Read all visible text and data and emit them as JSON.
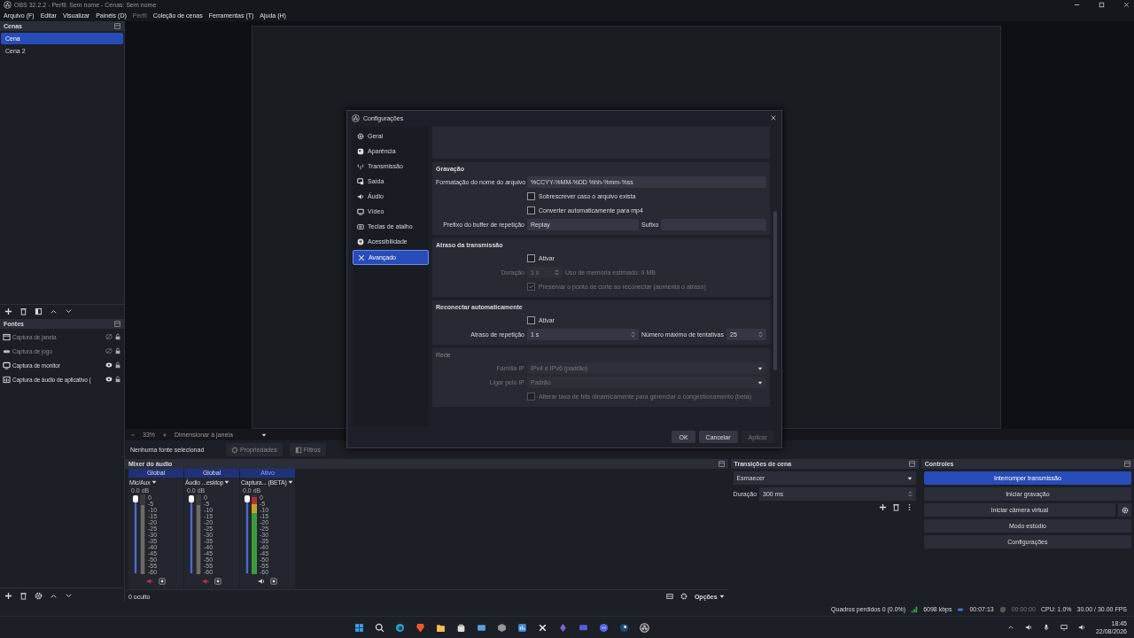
{
  "window": {
    "title": "OBS 32.2.2 - Perfil: Sem nome - Cenas: Sem nome"
  },
  "menu": [
    {
      "label": "Arquivo (F)",
      "disabled": false
    },
    {
      "label": "Editar",
      "disabled": false
    },
    {
      "label": "Visualizar",
      "disabled": false
    },
    {
      "label": "Painéis (D)",
      "disabled": false
    },
    {
      "label": "Perfil",
      "disabled": true
    },
    {
      "label": "Coleção de cenas",
      "disabled": false
    },
    {
      "label": "Ferramentas (T)",
      "disabled": false
    },
    {
      "label": "Ajuda (H)",
      "disabled": false
    }
  ],
  "scenes": {
    "title": "Cenas",
    "items": [
      {
        "label": "Cena",
        "selected": true
      },
      {
        "label": "Cena 2",
        "selected": false
      }
    ]
  },
  "sources": {
    "title": "Fontes",
    "items": [
      {
        "label": "Captura de janela",
        "kind": "window",
        "visible": false
      },
      {
        "label": "Captura de jogo",
        "kind": "game",
        "visible": false
      },
      {
        "label": "Captura de monitor",
        "kind": "monitor",
        "visible": true
      },
      {
        "label": "Captura de áudio de aplicativo (",
        "kind": "app-audio",
        "visible": true
      }
    ]
  },
  "preview": {
    "zoom": "33%",
    "scale_mode": "Dimensionar à janela"
  },
  "source_toolbar": {
    "status": "Nenhuma fonte selecionad",
    "buttons": [
      "Propriedades",
      "Filtros"
    ]
  },
  "mixer": {
    "title": "Mixer do áudio",
    "hidden": "0 oculto",
    "options": "Opções",
    "channels": [
      {
        "tag": "Global",
        "name": "Mic/Aux",
        "db": "0.0 dB",
        "level": 1,
        "muted": true,
        "active": false,
        "scale": [
          "0",
          "-5",
          "-10",
          "-15",
          "-20",
          "-25",
          "-30",
          "-35",
          "-40",
          "-45",
          "-50",
          "-55",
          "-60"
        ]
      },
      {
        "tag": "Global",
        "name": "Áudio ...esktop",
        "db": "0.0 dB",
        "level": 1,
        "muted": true,
        "active": false,
        "scale": [
          "0",
          "-5",
          "-10",
          "-15",
          "-20",
          "-25",
          "-30",
          "-35",
          "-40",
          "-45",
          "-50",
          "-55",
          "-60"
        ]
      },
      {
        "tag": "Ativo",
        "name": "Captura... (BETA)",
        "db": "0.0 dB",
        "level": 1,
        "muted": false,
        "active": true,
        "scale": [
          "0",
          "-5",
          "-10",
          "-15",
          "-20",
          "-25",
          "-30",
          "-35",
          "-40",
          "-45",
          "-50",
          "-55",
          "-60"
        ]
      }
    ]
  },
  "transitions": {
    "title": "Transições de cena",
    "value": "Esmaecer",
    "duration_label": "Duração",
    "duration": "300 ms"
  },
  "controls": {
    "title": "Controles",
    "buttons": [
      {
        "label": "Interromper transmissão",
        "active": true
      },
      {
        "label": "Iniciar gravação",
        "active": false
      },
      {
        "label": "Iniciar câmera virtual",
        "active": false
      },
      {
        "label": "Modo estúdio",
        "active": false
      },
      {
        "label": "Configurações",
        "active": false
      }
    ]
  },
  "status_bar": {
    "dropped": "Quadros perdidos 0 (0.0%)",
    "bitrate": "6098 kbps",
    "stream_time": "00:07:13",
    "rec_time": "00:00:00",
    "cpu": "CPU: 1.0%",
    "fps": "30.00 / 30.00 FPS"
  },
  "taskbar": {
    "time": "18:45",
    "date": "22/08/2026"
  },
  "dialog": {
    "title": "Configurações",
    "nav": [
      {
        "label": "Geral",
        "kind": "gear",
        "selected": false
      },
      {
        "label": "Aparência",
        "kind": "palette",
        "selected": false
      },
      {
        "label": "Transmissão",
        "kind": "antenna",
        "selected": false
      },
      {
        "label": "Saída",
        "kind": "output",
        "selected": false
      },
      {
        "label": "Áudio",
        "kind": "speaker",
        "selected": false
      },
      {
        "label": "Vídeo",
        "kind": "monitor",
        "selected": false
      },
      {
        "label": "Teclas de atalho",
        "kind": "keyboard",
        "selected": false
      },
      {
        "label": "Acessibilidade",
        "kind": "access",
        "selected": false
      },
      {
        "label": "Avançado",
        "kind": "tools",
        "selected": true
      }
    ],
    "sections": [
      {
        "title": "Gravação",
        "disabled": false,
        "rows": [
          {
            "kind": "text",
            "label": "Formatação do nome do arquivo",
            "value": "%CCYY-%MM-%DD %hh-%mm-%ss",
            "disabled": false
          },
          {
            "kind": "check",
            "label": "Sobrescrever caso o arquivo exista",
            "checked": false,
            "disabled": false
          },
          {
            "kind": "check",
            "label": "Converter automaticamente para mp4",
            "checked": false,
            "disabled": false
          },
          {
            "kind": "text-pair",
            "label": "Prefixo do buffer de repetição",
            "value": "Replay",
            "label2": "Sufixo",
            "disabled": false
          }
        ]
      },
      {
        "title": "Atraso da transmissão",
        "disabled": false,
        "rows": [
          {
            "kind": "check",
            "label": "Ativar",
            "checked": false,
            "disabled": false
          },
          {
            "kind": "spin",
            "label": "Duração",
            "value": "1 s",
            "note": "Uso de memória estimado: 0 MB",
            "disabled": true
          },
          {
            "kind": "check",
            "label": "Preservar o ponto de corte ao reconectar (aumenta o atraso)",
            "checked": true,
            "disabled": true
          }
        ]
      },
      {
        "title": "Reconectar automaticamente",
        "disabled": false,
        "rows": [
          {
            "kind": "check",
            "label": "Ativar",
            "checked": false,
            "disabled": false
          },
          {
            "kind": "spin-pair",
            "label": "Atraso de repetição",
            "value": "1 s",
            "label2": "Número máximo de tentativas",
            "value2": "25",
            "disabled": false
          }
        ]
      },
      {
        "title": "Rede",
        "disabled": true,
        "rows": [
          {
            "kind": "select",
            "label": "Família IP",
            "value": "IPv4 e IPv6 (padrão)",
            "disabled": true
          },
          {
            "kind": "select",
            "label": "Ligar pelo IP",
            "value": "Padrão",
            "disabled": true
          },
          {
            "kind": "check",
            "label": "Alterar taxa de bits dinamicamente para gerenciar o congestionamento (beta)",
            "checked": false,
            "disabled": true
          }
        ]
      }
    ],
    "buttons": [
      {
        "label": "OK",
        "disabled": false
      },
      {
        "label": "Cancelar",
        "disabled": false
      },
      {
        "label": "Aplicar",
        "disabled": true
      }
    ]
  }
}
